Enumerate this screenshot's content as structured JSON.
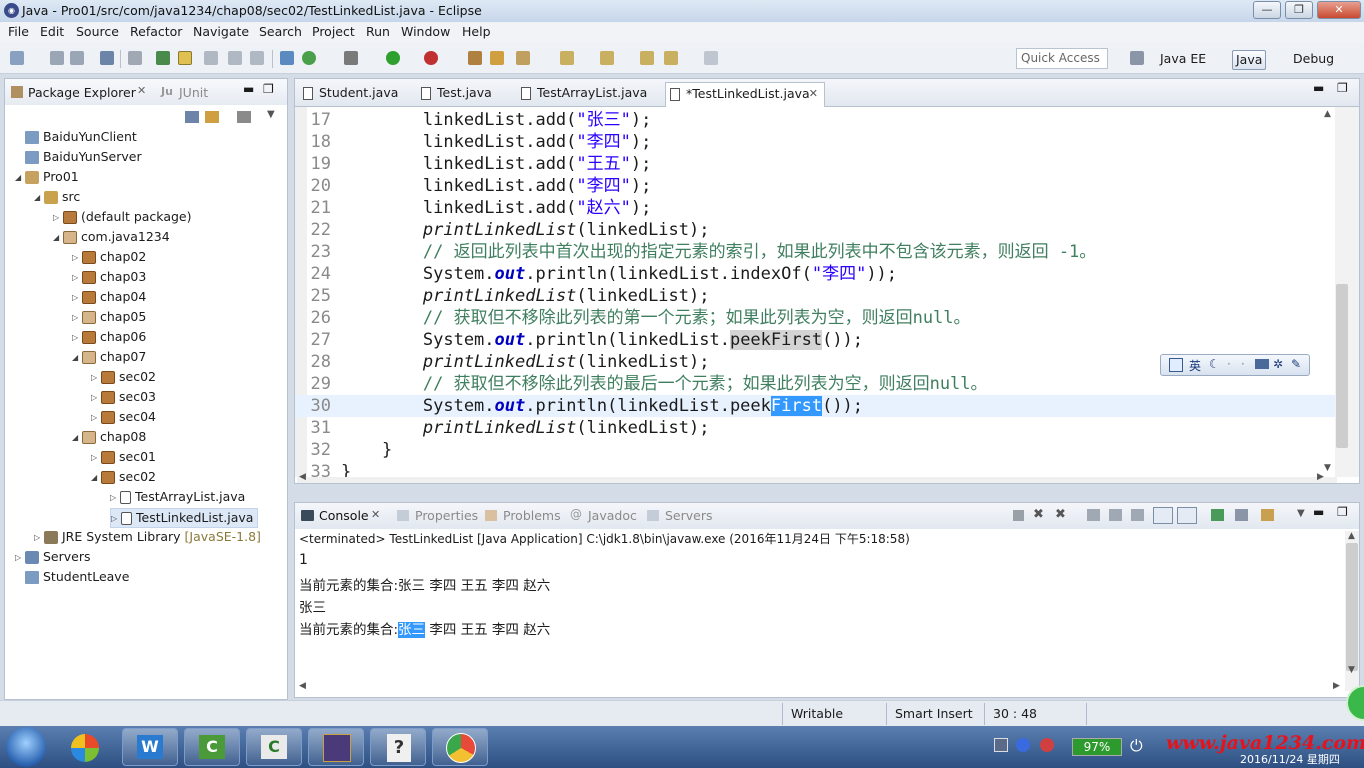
{
  "window": {
    "title": "Java - Pro01/src/com/java1234/chap08/sec02/TestLinkedList.java - Eclipse",
    "minimize": "—",
    "maximize": "❐",
    "close": "✕"
  },
  "menu": [
    "File",
    "Edit",
    "Source",
    "Refactor",
    "Navigate",
    "Search",
    "Project",
    "Run",
    "Window",
    "Help"
  ],
  "toolbar": {
    "quick_access": "Quick Access",
    "perspectives": [
      "Java EE",
      "Java",
      "Debug"
    ]
  },
  "explorer": {
    "tabs": [
      "Package Explorer",
      "JUnit"
    ],
    "tree": [
      {
        "label": "BaiduYunClient",
        "icon": "folder",
        "depth": 0,
        "tw": ""
      },
      {
        "label": "BaiduYunServer",
        "icon": "folder",
        "depth": 0,
        "tw": ""
      },
      {
        "label": "Pro01",
        "icon": "proj",
        "depth": 0,
        "tw": "◢"
      },
      {
        "label": "src",
        "icon": "src",
        "depth": 1,
        "tw": "◢"
      },
      {
        "label": "(default package)",
        "icon": "pkg",
        "depth": 2,
        "tw": "▷"
      },
      {
        "label": "com.java1234",
        "icon": "pkg2",
        "depth": 2,
        "tw": "◢"
      },
      {
        "label": "chap02",
        "icon": "pkg",
        "depth": 3,
        "tw": "▷"
      },
      {
        "label": "chap03",
        "icon": "pkg",
        "depth": 3,
        "tw": "▷"
      },
      {
        "label": "chap04",
        "icon": "pkg",
        "depth": 3,
        "tw": "▷"
      },
      {
        "label": "chap05",
        "icon": "pkg2",
        "depth": 3,
        "tw": "▷"
      },
      {
        "label": "chap06",
        "icon": "pkg",
        "depth": 3,
        "tw": "▷"
      },
      {
        "label": "chap07",
        "icon": "pkg2",
        "depth": 3,
        "tw": "◢"
      },
      {
        "label": "sec02",
        "icon": "pkg",
        "depth": 4,
        "tw": "▷"
      },
      {
        "label": "sec03",
        "icon": "pkg",
        "depth": 4,
        "tw": "▷"
      },
      {
        "label": "sec04",
        "icon": "pkg",
        "depth": 4,
        "tw": "▷"
      },
      {
        "label": "chap08",
        "icon": "pkg2",
        "depth": 3,
        "tw": "◢"
      },
      {
        "label": "sec01",
        "icon": "pkg",
        "depth": 4,
        "tw": "▷"
      },
      {
        "label": "sec02",
        "icon": "pkg",
        "depth": 4,
        "tw": "◢"
      },
      {
        "label": "TestArrayList.java",
        "icon": "java",
        "depth": 5,
        "tw": "▷"
      },
      {
        "label": "TestLinkedList.java",
        "icon": "java",
        "depth": 5,
        "tw": "▷",
        "selected": true
      },
      {
        "label": "JRE System Library",
        "icon": "jre",
        "depth": 1,
        "tw": "▷",
        "suffix": "[JavaSE-1.8]"
      },
      {
        "label": "Servers",
        "icon": "srv",
        "depth": 0,
        "tw": "▷"
      },
      {
        "label": "StudentLeave",
        "icon": "folder",
        "depth": 0,
        "tw": ""
      }
    ]
  },
  "editor": {
    "tabs": [
      "Student.java",
      "Test.java",
      "TestArrayList.java",
      "*TestLinkedList.java"
    ],
    "lines": [
      {
        "n": "17",
        "segs": [
          {
            "t": "        linkedList.add("
          },
          {
            "t": "\"张三\"",
            "c": "str"
          },
          {
            "t": ");"
          }
        ]
      },
      {
        "n": "18",
        "segs": [
          {
            "t": "        linkedList.add("
          },
          {
            "t": "\"李四\"",
            "c": "str"
          },
          {
            "t": ");"
          }
        ]
      },
      {
        "n": "19",
        "segs": [
          {
            "t": "        linkedList.add("
          },
          {
            "t": "\"王五\"",
            "c": "str"
          },
          {
            "t": ");"
          }
        ]
      },
      {
        "n": "20",
        "segs": [
          {
            "t": "        linkedList.add("
          },
          {
            "t": "\"李四\"",
            "c": "str"
          },
          {
            "t": ");"
          }
        ]
      },
      {
        "n": "21",
        "segs": [
          {
            "t": "        linkedList.add("
          },
          {
            "t": "\"赵六\"",
            "c": "str"
          },
          {
            "t": ");"
          }
        ]
      },
      {
        "n": "22",
        "segs": [
          {
            "t": "        "
          },
          {
            "t": "printLinkedList",
            "c": "it"
          },
          {
            "t": "(linkedList);"
          }
        ]
      },
      {
        "n": "23",
        "segs": [
          {
            "t": "        // 返回此列表中首次出现的指定元素的索引，如果此列表中不包含该元素，则返回 -1。",
            "c": "cmt"
          }
        ]
      },
      {
        "n": "24",
        "segs": [
          {
            "t": "        System."
          },
          {
            "t": "out",
            "c": "out"
          },
          {
            "t": ".println(linkedList.indexOf("
          },
          {
            "t": "\"李四\"",
            "c": "str"
          },
          {
            "t": "));"
          }
        ]
      },
      {
        "n": "25",
        "segs": [
          {
            "t": "        "
          },
          {
            "t": "printLinkedList",
            "c": "it"
          },
          {
            "t": "(linkedList);"
          }
        ]
      },
      {
        "n": "26",
        "segs": [
          {
            "t": "        // 获取但不移除此列表的第一个元素；如果此列表为空，则返回null。",
            "c": "cmt"
          }
        ]
      },
      {
        "n": "27",
        "segs": [
          {
            "t": "        System."
          },
          {
            "t": "out",
            "c": "out"
          },
          {
            "t": ".println(linkedList."
          },
          {
            "t": "peekFirst",
            "c": "mark"
          },
          {
            "t": "());"
          }
        ]
      },
      {
        "n": "28",
        "segs": [
          {
            "t": "        "
          },
          {
            "t": "printLinkedList",
            "c": "it"
          },
          {
            "t": "(linkedList);"
          }
        ]
      },
      {
        "n": "29",
        "segs": [
          {
            "t": "        // 获取但不移除此列表的最后一个元素；如果此列表为空，则返回null。",
            "c": "cmt"
          }
        ]
      },
      {
        "n": "30",
        "segs": [
          {
            "t": "        System."
          },
          {
            "t": "out",
            "c": "out"
          },
          {
            "t": ".println(linkedList.peek"
          },
          {
            "t": "First",
            "c": "sel"
          },
          {
            "t": "());"
          }
        ],
        "current": true
      },
      {
        "n": "31",
        "segs": [
          {
            "t": "        "
          },
          {
            "t": "printLinkedList",
            "c": "it"
          },
          {
            "t": "(linkedList);"
          }
        ]
      },
      {
        "n": "32",
        "segs": [
          {
            "t": "    }"
          }
        ]
      },
      {
        "n": "33",
        "segs": [
          {
            "t": "}"
          }
        ]
      }
    ]
  },
  "ime": {
    "lang": "英"
  },
  "console": {
    "tabs": [
      "Console",
      "Properties",
      "Problems",
      "Javadoc",
      "Servers"
    ],
    "header": "<terminated> TestLinkedList [Java Application] C:\\jdk1.8\\bin\\javaw.exe (2016年11月24日 下午5:18:58)",
    "lines": [
      "1",
      "当前元素的集合:张三 李四 王五 李四 赵六",
      "张三"
    ],
    "last_prefix": "当前元素的集合:",
    "last_selected": "张三",
    "last_rest": " 李四 王五 李四 赵六"
  },
  "status": {
    "writable": "Writable",
    "insert": "Smart Insert",
    "position": "30 : 48"
  },
  "taskbar": {
    "battery": "97%",
    "watermark": "www.java1234.com",
    "date": "2016/11/24 星期四"
  },
  "colors": {
    "selection": "#3399ff",
    "string": "#2a00ff",
    "comment": "#3f7f5f",
    "field": "#0000c0",
    "watermark": "#e8121a"
  }
}
